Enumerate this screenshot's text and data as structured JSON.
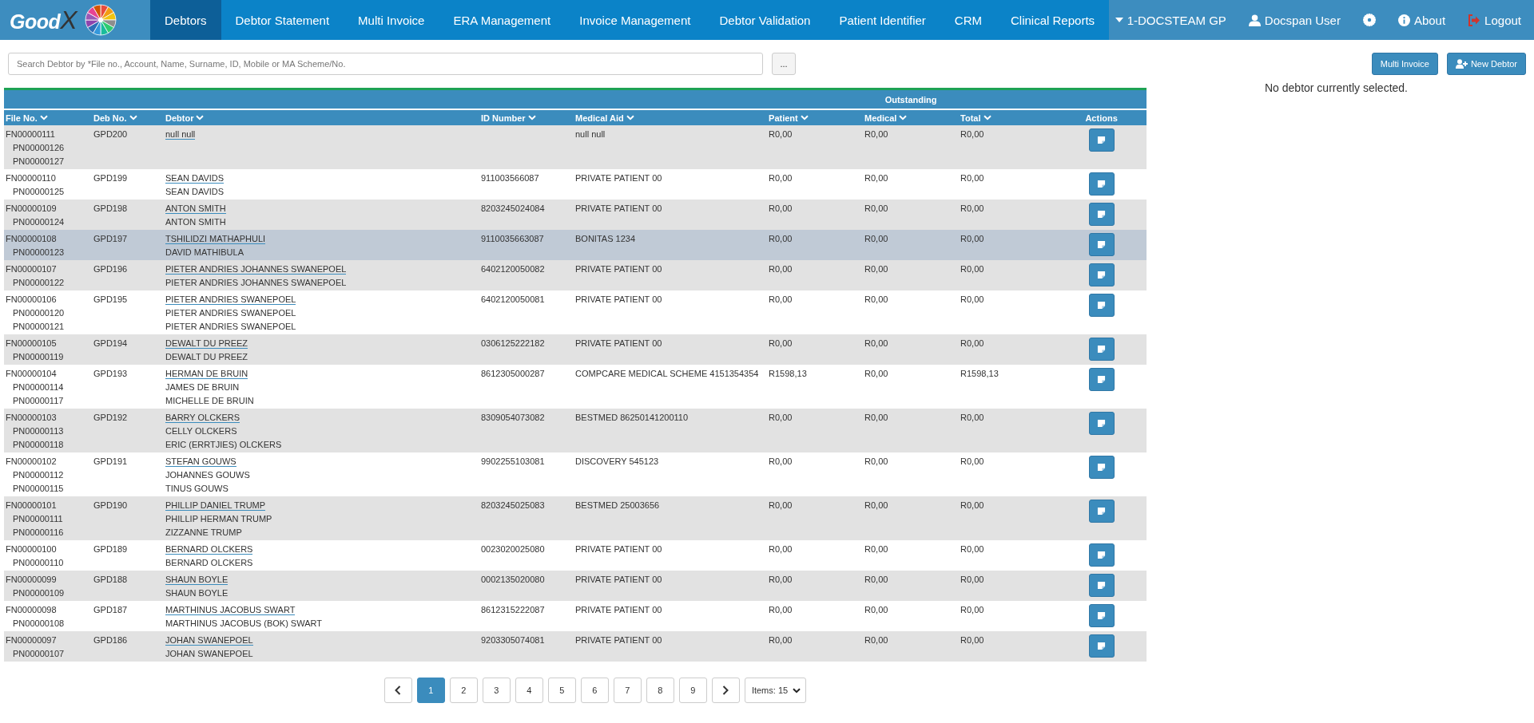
{
  "logo": {
    "text": "Good",
    "mark": "X"
  },
  "nav": [
    {
      "label": "Debtors",
      "selected": true
    },
    {
      "label": "Debtor Statement",
      "selected": false
    },
    {
      "label": "Multi Invoice",
      "selected": false
    },
    {
      "label": "ERA Management",
      "selected": false
    },
    {
      "label": "Invoice Management",
      "selected": false
    },
    {
      "label": "Debtor Validation",
      "selected": false
    },
    {
      "label": "Patient Identifier",
      "selected": false
    },
    {
      "label": "CRM",
      "selected": false
    },
    {
      "label": "Clinical Reports",
      "selected": false
    }
  ],
  "user_bar": {
    "practice": "1-DOCSTEAM GP",
    "user": "Docspan User",
    "about": "About",
    "logout": "Logout"
  },
  "search": {
    "placeholder": "Search Debtor by *File no., Account, Name, Surname, ID, Mobile or MA Scheme/No.",
    "more_button": "..."
  },
  "buttons": {
    "multi_invoice": "Multi Invoice",
    "new_debtor": "New Debtor"
  },
  "detail_message": "No debtor currently selected.",
  "table": {
    "group_heading": "Outstanding",
    "columns": [
      "File No.",
      "Deb No.",
      "Debtor",
      "ID Number",
      "Medical Aid",
      "Patient",
      "Medical",
      "Total",
      "Actions"
    ],
    "rows": [
      {
        "file_no": "FN00000111",
        "patient_nos": [
          "PN00000126",
          "PN00000127"
        ],
        "deb_no": "GPD200",
        "debtor": "null null",
        "patients": [],
        "id_number": "",
        "medical_aid": "null null",
        "patient": "R0,00",
        "medical": "R0,00",
        "total": "R0,00",
        "selected": false
      },
      {
        "file_no": "FN00000110",
        "patient_nos": [
          "PN00000125"
        ],
        "deb_no": "GPD199",
        "debtor": "SEAN DAVIDS",
        "patients": [
          "SEAN DAVIDS"
        ],
        "id_number": "911003566087",
        "medical_aid": "PRIVATE PATIENT 00",
        "patient": "R0,00",
        "medical": "R0,00",
        "total": "R0,00",
        "selected": false
      },
      {
        "file_no": "FN00000109",
        "patient_nos": [
          "PN00000124"
        ],
        "deb_no": "GPD198",
        "debtor": "ANTON SMITH",
        "patients": [
          "ANTON SMITH"
        ],
        "id_number": "8203245024084",
        "medical_aid": "PRIVATE PATIENT 00",
        "patient": "R0,00",
        "medical": "R0,00",
        "total": "R0,00",
        "selected": false
      },
      {
        "file_no": "FN00000108",
        "patient_nos": [
          "PN00000123"
        ],
        "deb_no": "GPD197",
        "debtor": "TSHILIDZI MATHAPHULI",
        "patients": [
          "DAVID MATHIBULA"
        ],
        "id_number": "9110035663087",
        "medical_aid": "BONITAS 1234",
        "patient": "R0,00",
        "medical": "R0,00",
        "total": "R0,00",
        "selected": true
      },
      {
        "file_no": "FN00000107",
        "patient_nos": [
          "PN00000122"
        ],
        "deb_no": "GPD196",
        "debtor": "PIETER ANDRIES JOHANNES SWANEPOEL",
        "patients": [
          "PIETER ANDRIES JOHANNES SWANEPOEL"
        ],
        "id_number": "6402120050082",
        "medical_aid": "PRIVATE PATIENT 00",
        "patient": "R0,00",
        "medical": "R0,00",
        "total": "R0,00",
        "selected": false
      },
      {
        "file_no": "FN00000106",
        "patient_nos": [
          "PN00000120",
          "PN00000121"
        ],
        "deb_no": "GPD195",
        "debtor": "PIETER ANDRIES SWANEPOEL",
        "patients": [
          "PIETER ANDRIES SWANEPOEL",
          "PIETER ANDRIES SWANEPOEL"
        ],
        "id_number": "6402120050081",
        "medical_aid": "PRIVATE PATIENT 00",
        "patient": "R0,00",
        "medical": "R0,00",
        "total": "R0,00",
        "selected": false
      },
      {
        "file_no": "FN00000105",
        "patient_nos": [
          "PN00000119"
        ],
        "deb_no": "GPD194",
        "debtor": "DEWALT DU PREEZ",
        "patients": [
          "DEWALT DU PREEZ"
        ],
        "id_number": "0306125222182",
        "medical_aid": "PRIVATE PATIENT 00",
        "patient": "R0,00",
        "medical": "R0,00",
        "total": "R0,00",
        "selected": false
      },
      {
        "file_no": "FN00000104",
        "patient_nos": [
          "PN00000114",
          "PN00000117"
        ],
        "deb_no": "GPD193",
        "debtor": "HERMAN DE BRUIN",
        "patients": [
          "JAMES DE BRUIN",
          "MICHELLE DE BRUIN"
        ],
        "id_number": "8612305000287",
        "medical_aid": "COMPCARE MEDICAL SCHEME 4151354354",
        "patient": "R1598,13",
        "medical": "R0,00",
        "total": "R1598,13",
        "selected": false
      },
      {
        "file_no": "FN00000103",
        "patient_nos": [
          "PN00000113",
          "PN00000118"
        ],
        "deb_no": "GPD192",
        "debtor": "BARRY OLCKERS",
        "patients": [
          "CELLY OLCKERS",
          "ERIC (ERRTJIES) OLCKERS"
        ],
        "id_number": "8309054073082",
        "medical_aid": "BESTMED 86250141200110",
        "patient": "R0,00",
        "medical": "R0,00",
        "total": "R0,00",
        "selected": false
      },
      {
        "file_no": "FN00000102",
        "patient_nos": [
          "PN00000112",
          "PN00000115"
        ],
        "deb_no": "GPD191",
        "debtor": "STEFAN GOUWS",
        "patients": [
          "JOHANNES GOUWS",
          "TINUS GOUWS"
        ],
        "id_number": "9902255103081",
        "medical_aid": "DISCOVERY 545123",
        "patient": "R0,00",
        "medical": "R0,00",
        "total": "R0,00",
        "selected": false
      },
      {
        "file_no": "FN00000101",
        "patient_nos": [
          "PN00000111",
          "PN00000116"
        ],
        "deb_no": "GPD190",
        "debtor": "PHILLIP DANIEL TRUMP",
        "patients": [
          "PHILLIP HERMAN TRUMP",
          "ZIZZANNE TRUMP"
        ],
        "id_number": "8203245025083",
        "medical_aid": "BESTMED 25003656",
        "patient": "R0,00",
        "medical": "R0,00",
        "total": "R0,00",
        "selected": false
      },
      {
        "file_no": "FN00000100",
        "patient_nos": [
          "PN00000110"
        ],
        "deb_no": "GPD189",
        "debtor": "BERNARD OLCKERS",
        "patients": [
          "BERNARD OLCKERS"
        ],
        "id_number": "0023020025080",
        "medical_aid": "PRIVATE PATIENT 00",
        "patient": "R0,00",
        "medical": "R0,00",
        "total": "R0,00",
        "selected": false
      },
      {
        "file_no": "FN00000099",
        "patient_nos": [
          "PN00000109"
        ],
        "deb_no": "GPD188",
        "debtor": "SHAUN BOYLE",
        "patients": [
          "SHAUN BOYLE"
        ],
        "id_number": "0002135020080",
        "medical_aid": "PRIVATE PATIENT 00",
        "patient": "R0,00",
        "medical": "R0,00",
        "total": "R0,00",
        "selected": false
      },
      {
        "file_no": "FN00000098",
        "patient_nos": [
          "PN00000108"
        ],
        "deb_no": "GPD187",
        "debtor": "MARTHINUS JACOBUS SWART",
        "patients": [
          "MARTHINUS JACOBUS (BOK) SWART"
        ],
        "id_number": "8612315222087",
        "medical_aid": "PRIVATE PATIENT 00",
        "patient": "R0,00",
        "medical": "R0,00",
        "total": "R0,00",
        "selected": false
      },
      {
        "file_no": "FN00000097",
        "patient_nos": [
          "PN00000107"
        ],
        "deb_no": "GPD186",
        "debtor": "JOHAN SWANEPOEL",
        "patients": [
          "JOHAN SWANEPOEL"
        ],
        "id_number": "9203305074081",
        "medical_aid": "PRIVATE PATIENT 00",
        "patient": "R0,00",
        "medical": "R0,00",
        "total": "R0,00",
        "selected": false
      }
    ]
  },
  "pagination": {
    "pages": [
      {
        "label": "1",
        "selected": true
      },
      {
        "label": "2",
        "selected": false
      },
      {
        "label": "3",
        "selected": false
      },
      {
        "label": "4",
        "selected": false
      },
      {
        "label": "5",
        "selected": false
      },
      {
        "label": "6",
        "selected": false
      },
      {
        "label": "7",
        "selected": false
      },
      {
        "label": "8",
        "selected": false
      },
      {
        "label": "9",
        "selected": false
      }
    ],
    "items_select": "Items: 15"
  }
}
